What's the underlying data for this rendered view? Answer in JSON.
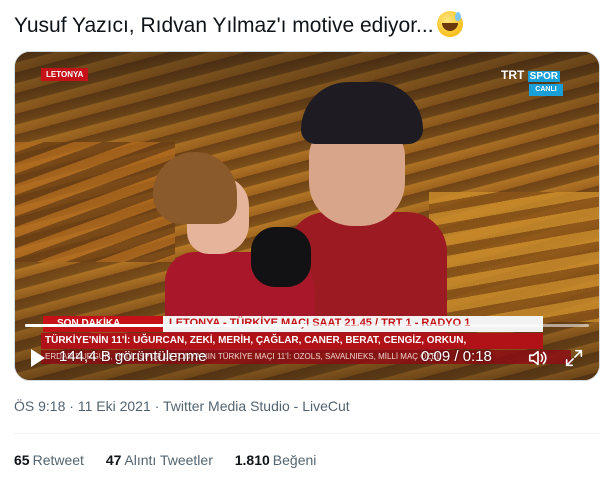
{
  "tweet": {
    "text": "Yusuf Yazıcı, Rıdvan Yılmaz'ı motive ediyor...",
    "emoji": "sweat-smile-emoji"
  },
  "video": {
    "overlay_tag": "LETONYA",
    "broadcaster": "TRT",
    "broadcaster_sub": "SPOR",
    "live_label": "CANLI",
    "ticker_label": "SON DAKİKA",
    "ticker_headline": "LETONYA - TÜRKİYE MAÇI SAAT 21.45 / TRT 1 - RADYO 1",
    "ticker_line2": "TÜRKİYE'NİN 11'İ: UĞURCAN, ZEKİ, MERİH, ÇAĞLAR, CANER, BERAT, CENGİZ, ORKUN,",
    "ticker_line3": "ERDAR DURGUN, HALİL     SPOR   LETONYA'NIN TÜRKİYE MAÇI 11'İ: OZOLS, SAVALNIEKS, MİLLİ MAÇ ÖZEL",
    "views": "144,4 B görüntülenme",
    "time": "0:09 / 0:18",
    "progress": 0.5
  },
  "meta": {
    "time": "ÖS 9:18",
    "date": "11 Eki 2021",
    "source": "Twitter Media Studio - LiveCut",
    "separator": "·"
  },
  "stats": {
    "retweets_count": "65",
    "retweets_label": "Retweet",
    "quotes_count": "47",
    "quotes_label": "Alıntı Tweetler",
    "likes_count": "1.810",
    "likes_label": "Beğeni"
  }
}
